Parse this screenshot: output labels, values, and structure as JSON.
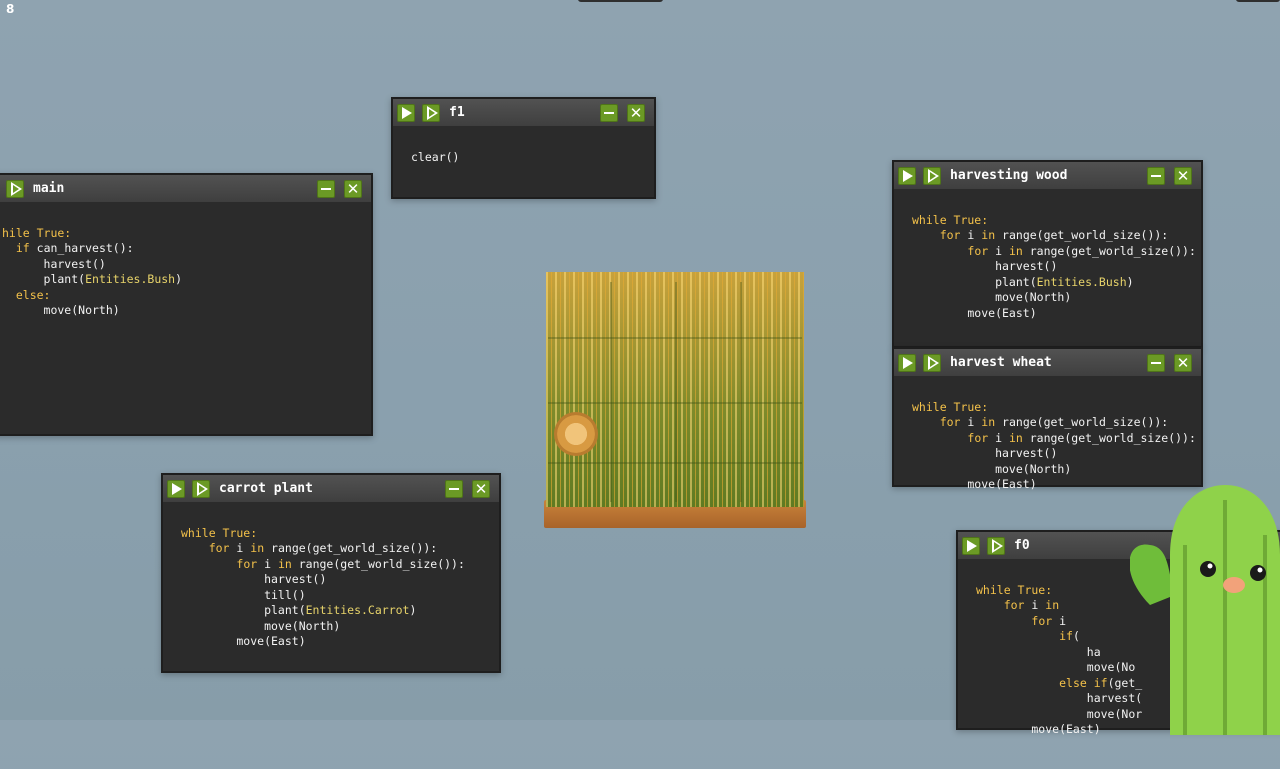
{
  "counter": "8",
  "colors": {
    "button_green": "#6b9a25",
    "window_bg": "#2b2b2b",
    "keyword": "#f3c14a",
    "entity": "#e7d36a"
  },
  "windows": {
    "main": {
      "title": "main",
      "lines": [
        "hile True:",
        "  if can_harvest():",
        "      harvest()",
        "      plant(Entities.Bush)",
        "  else:",
        "      move(North)"
      ]
    },
    "f1": {
      "title": "f1",
      "lines": [
        "clear()"
      ]
    },
    "harvesting_wood": {
      "title": "harvesting wood",
      "lines": [
        "while True:",
        "    for i in range(get_world_size()):",
        "        for i in range(get_world_size()):",
        "            harvest()",
        "            plant(Entities.Bush)",
        "            move(North)",
        "        move(East)"
      ]
    },
    "harvest_wheat": {
      "title": "harvest wheat",
      "lines": [
        "while True:",
        "    for i in range(get_world_size()):",
        "        for i in range(get_world_size()):",
        "            harvest()",
        "            move(North)",
        "        move(East)"
      ]
    },
    "carrot_plant": {
      "title": "carrot plant",
      "lines": [
        "while True:",
        "    for i in range(get_world_size()):",
        "        for i in range(get_world_size()):",
        "            harvest()",
        "            till()",
        "            plant(Entities.Carrot)",
        "            move(North)",
        "        move(East)"
      ]
    },
    "f0": {
      "title": "f0",
      "lines": [
        "while True:",
        "    for i in",
        "        for i",
        "            if(",
        "                ha",
        "                move(No",
        "            else if(get_",
        "                harvest(",
        "                move(Nor",
        "        move(East)"
      ]
    }
  },
  "icons": {
    "run": "play-icon",
    "step": "step-icon",
    "minimize": "minimize-icon",
    "close": "close-icon"
  }
}
